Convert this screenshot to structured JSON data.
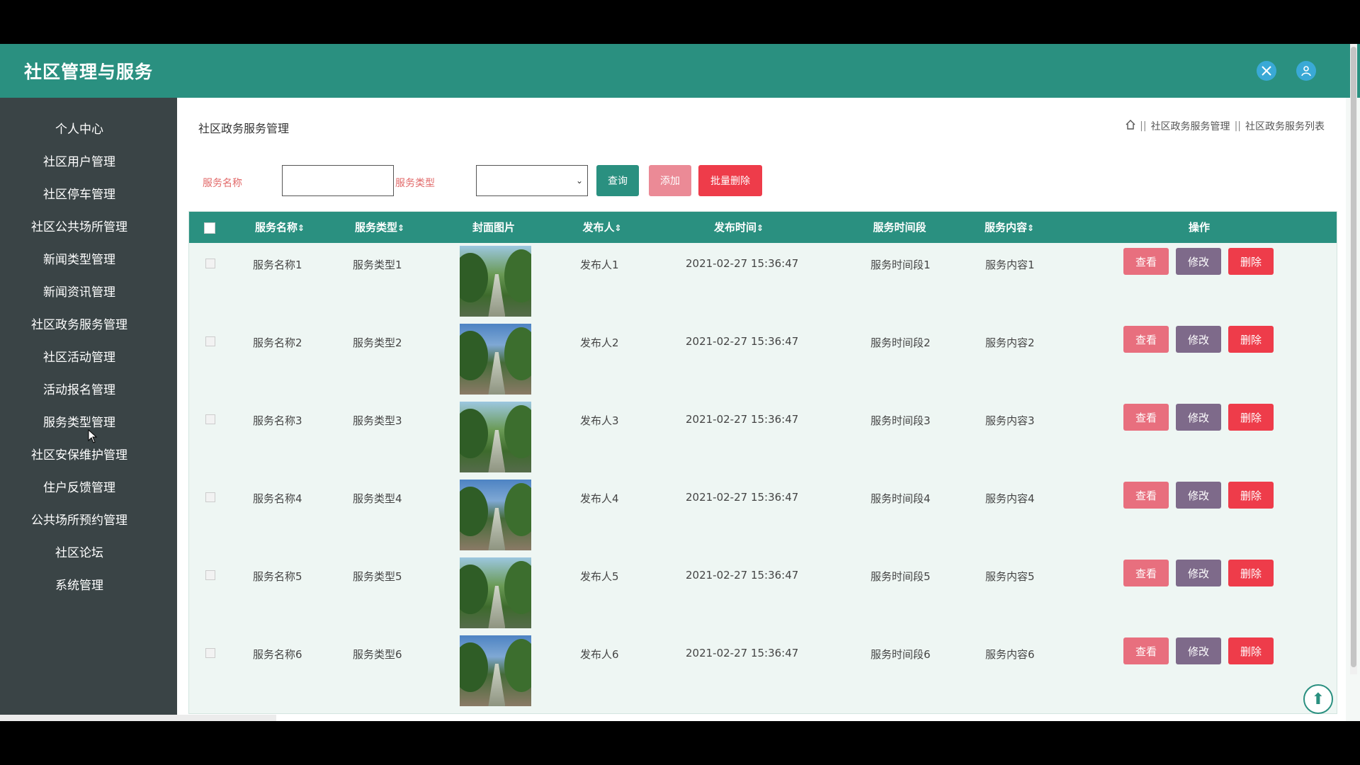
{
  "app": {
    "title": "社区管理与服务"
  },
  "topbar": {
    "icons": [
      "expand-icon",
      "user-icon"
    ]
  },
  "sidebar": {
    "items": [
      {
        "label": "个人中心"
      },
      {
        "label": "社区用户管理"
      },
      {
        "label": "社区停车管理"
      },
      {
        "label": "社区公共场所管理"
      },
      {
        "label": "新闻类型管理"
      },
      {
        "label": "新闻资讯管理"
      },
      {
        "label": "社区政务服务管理"
      },
      {
        "label": "社区活动管理"
      },
      {
        "label": "活动报名管理"
      },
      {
        "label": "服务类型管理"
      },
      {
        "label": "社区安保维护管理"
      },
      {
        "label": "住户反馈管理"
      },
      {
        "label": "公共场所预约管理"
      },
      {
        "label": "社区论坛"
      },
      {
        "label": "系统管理"
      }
    ]
  },
  "page": {
    "title": "社区政务服务管理",
    "breadcrumb": [
      "社区政务服务管理",
      "社区政务服务列表"
    ]
  },
  "filters": {
    "name_label": "服务名称",
    "name_value": "",
    "type_label": "服务类型",
    "type_value": "",
    "search_label": "查询",
    "add_label": "添加",
    "batch_delete_label": "批量删除"
  },
  "table": {
    "headers": [
      "服务名称",
      "服务类型",
      "封面图片",
      "发布人",
      "发布时间",
      "服务时间段",
      "服务内容",
      "操作"
    ],
    "sort_indicator": "⇕",
    "rows": [
      {
        "name": "服务名称1",
        "type": "服务类型1",
        "publisher": "发布人1",
        "time": "2021-02-27 15:36:47",
        "period": "服务时间段1",
        "content": "服务内容1"
      },
      {
        "name": "服务名称2",
        "type": "服务类型2",
        "publisher": "发布人2",
        "time": "2021-02-27 15:36:47",
        "period": "服务时间段2",
        "content": "服务内容2"
      },
      {
        "name": "服务名称3",
        "type": "服务类型3",
        "publisher": "发布人3",
        "time": "2021-02-27 15:36:47",
        "period": "服务时间段3",
        "content": "服务内容3"
      },
      {
        "name": "服务名称4",
        "type": "服务类型4",
        "publisher": "发布人4",
        "time": "2021-02-27 15:36:47",
        "period": "服务时间段4",
        "content": "服务内容4"
      },
      {
        "name": "服务名称5",
        "type": "服务类型5",
        "publisher": "发布人5",
        "time": "2021-02-27 15:36:47",
        "period": "服务时间段5",
        "content": "服务内容5"
      },
      {
        "name": "服务名称6",
        "type": "服务类型6",
        "publisher": "发布人6",
        "time": "2021-02-27 15:36:47",
        "period": "服务时间段6",
        "content": "服务内容6"
      }
    ],
    "action_labels": {
      "view": "查看",
      "edit": "修改",
      "delete": "删除"
    }
  },
  "colors": {
    "primary": "#2a9080",
    "sidebar": "#3a4446",
    "view": "#e86f7e",
    "edit": "#7e6a8a",
    "delete": "#ee3c4a"
  }
}
